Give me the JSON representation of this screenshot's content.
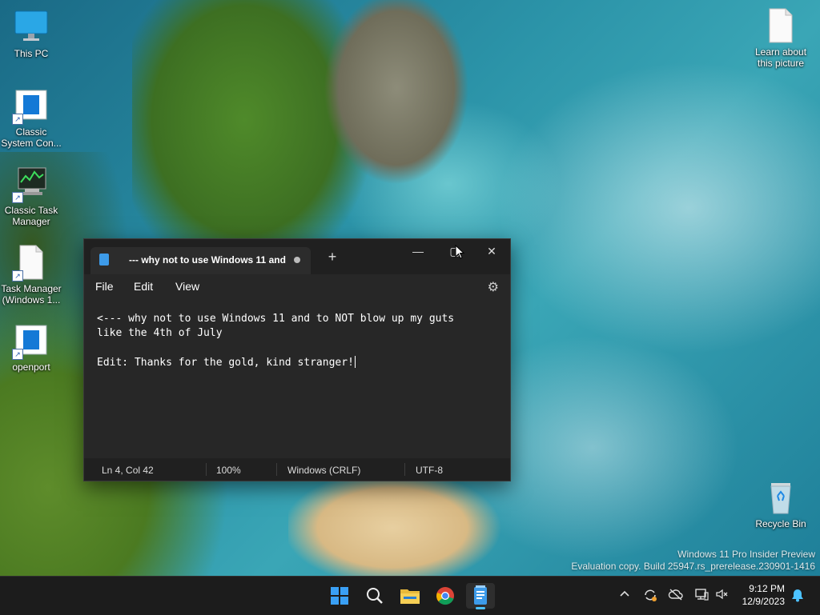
{
  "desktop": {
    "icons": [
      {
        "label": "This PC"
      },
      {
        "label": "Classic System Con..."
      },
      {
        "label": "Classic Task Manager"
      },
      {
        "label": "Task Manager (Windows 1..."
      },
      {
        "label": "openport"
      },
      {
        "label": "Learn about this picture"
      },
      {
        "label": "Recycle Bin"
      }
    ],
    "watermark": {
      "line1": "Windows 11 Pro Insider Preview",
      "line2": "Evaluation copy. Build 25947.rs_prerelease.230901-1416"
    }
  },
  "notepad": {
    "tab_title": "--- why not to use Windows 11 and",
    "new_tab": "+",
    "controls": {
      "minimize": "—",
      "maximize": "▢",
      "close": "✕"
    },
    "menu": {
      "file": "File",
      "edit": "Edit",
      "view": "View"
    },
    "editor_lines": [
      "<--- why not to use Windows 11 and to NOT blow up my guts",
      "like the 4th of July",
      "",
      "Edit: Thanks for the gold, kind stranger!"
    ],
    "status": {
      "position": "Ln 4, Col 42",
      "zoom": "100%",
      "line_ending": "Windows (CRLF)",
      "encoding": "UTF-8"
    }
  },
  "taskbar": {
    "apps": [
      "windows-start-icon",
      "search-icon",
      "file-explorer-icon",
      "chrome-icon",
      "notepad-icon"
    ],
    "clock": {
      "time": "9:12 PM",
      "date": "12/9/2023"
    }
  },
  "colors": {
    "accent": "#4cc2ff",
    "notepad_bg": "#272727",
    "taskbar_bg": "#1c1c1c"
  }
}
